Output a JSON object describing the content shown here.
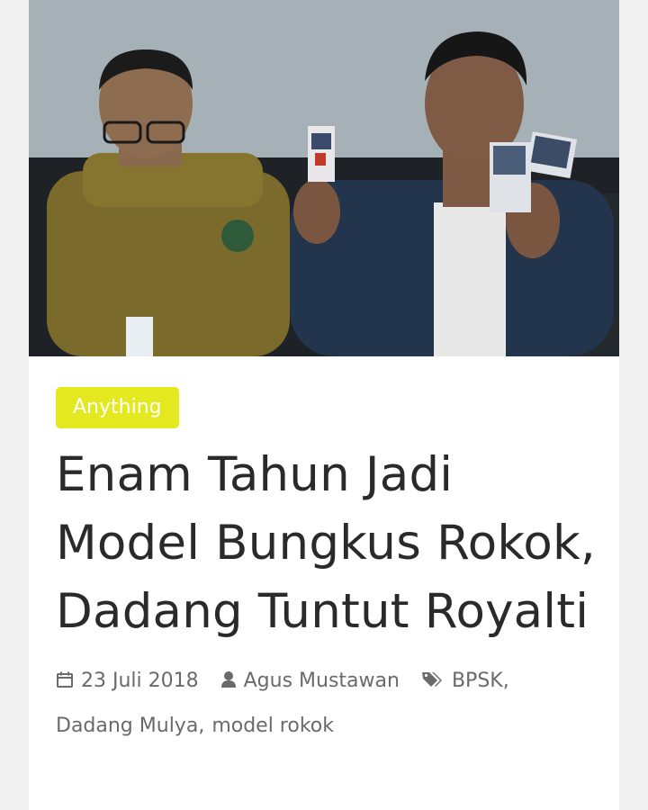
{
  "article": {
    "category": "Anything",
    "title": "Enam Tahun Jadi Model Bungkus Rokok, Dadang Tuntut Royalti",
    "date": "23 Juli 2018",
    "author": "Agus Mustawan",
    "tags": [
      "BPSK",
      "Dadang Mulya",
      "model rokok"
    ],
    "tag_separator": ","
  },
  "icons": {
    "date": "calendar-icon",
    "author": "user-icon",
    "tags": "tags-icon"
  },
  "colors": {
    "badge_bg": "#e4e81f",
    "title": "#2a2a2a",
    "meta": "#6a6a6a"
  }
}
